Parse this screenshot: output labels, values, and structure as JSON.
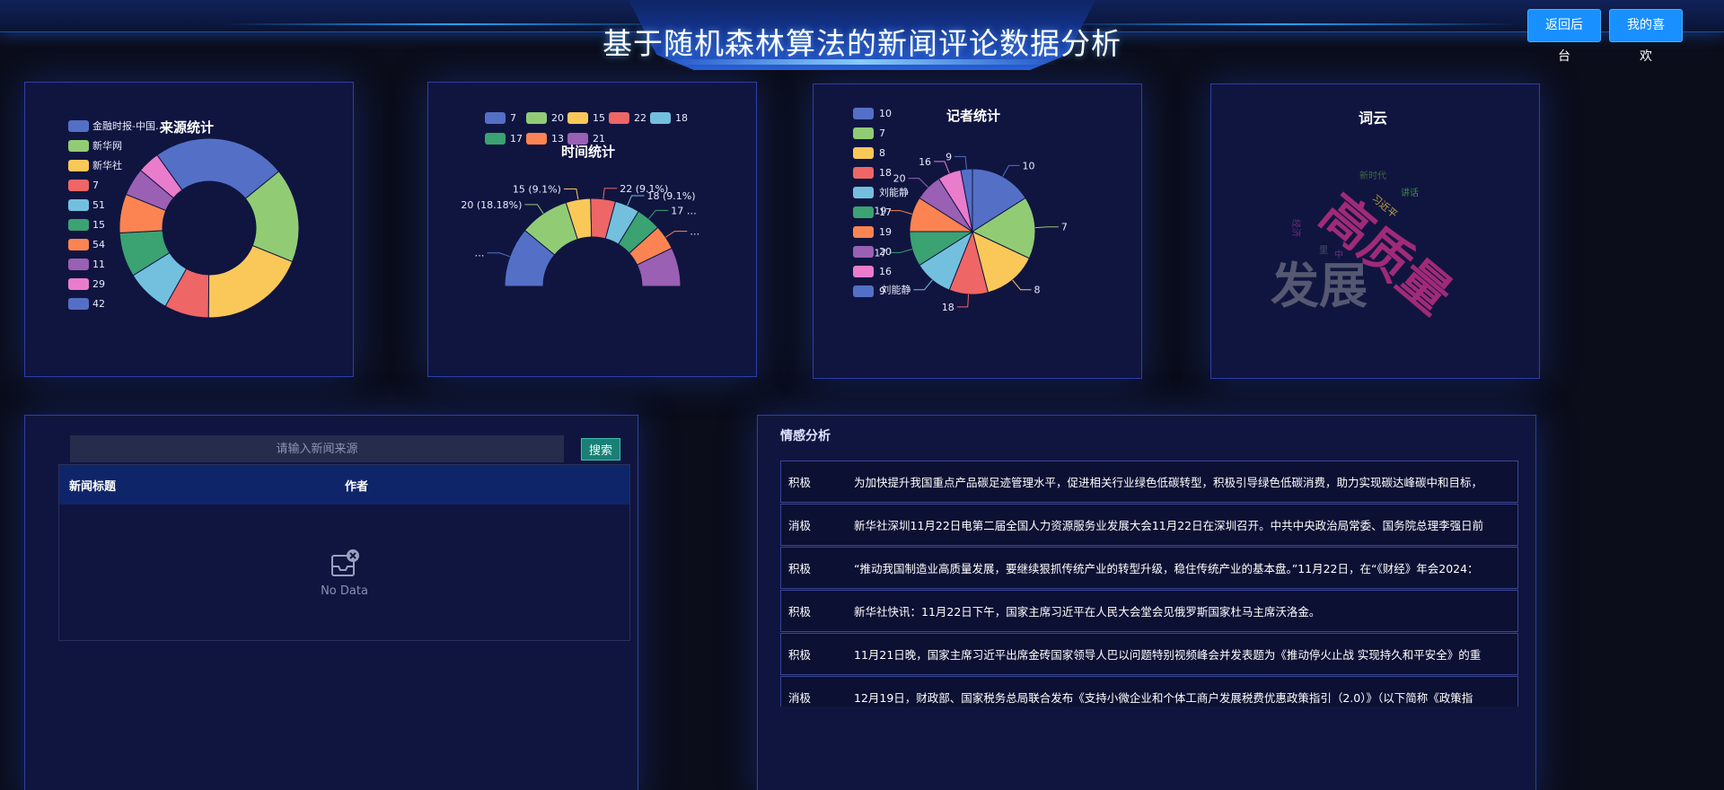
{
  "header": {
    "title": "基于随机森林算法的新闻评论数据分析",
    "buttons": {
      "back": "返回后台",
      "favorites": "我的喜欢"
    }
  },
  "charts": {
    "source": {
      "title": "来源统计",
      "legend": [
        "金融时报-中国…",
        "新华网",
        "新华社",
        "7",
        "51",
        "15",
        "54",
        "11",
        "29",
        "42"
      ]
    },
    "time": {
      "title": "时间统计",
      "legend": [
        "7",
        "20",
        "15",
        "22",
        "18",
        "17",
        "13",
        "21"
      ]
    },
    "reporter": {
      "title": "记者统计",
      "legend": [
        "10",
        "7",
        "8",
        "18",
        "刘能静",
        "17",
        "19",
        "20",
        "16",
        "9 刘能静"
      ]
    },
    "wordcloud": {
      "title": "词云"
    }
  },
  "chart_data": [
    {
      "type": "pie",
      "title": "来源统计",
      "donut": true,
      "legend_position": "left",
      "categories": [
        "金融时报-中国…",
        "新华网",
        "新华社",
        "7",
        "51",
        "15",
        "54",
        "11",
        "29",
        "42"
      ],
      "values": [
        24,
        17,
        19,
        8,
        8,
        8,
        7,
        5,
        4,
        0
      ]
    },
    {
      "type": "pie",
      "title": "时间统计",
      "half_donut": true,
      "legend_position": "top",
      "categories": [
        "7",
        "20",
        "15",
        "22",
        "18",
        "17",
        "13",
        "21"
      ],
      "values": [
        22,
        18.18,
        9.1,
        9.1,
        9.1,
        9.1,
        9.1,
        14.31
      ],
      "data_labels": [
        "…",
        "20 (18.18%)",
        "15 (9.1%)",
        "22 (9.1%)",
        "18 (9.1%)",
        "17 …",
        "…",
        ""
      ]
    },
    {
      "type": "pie",
      "title": "记者统计",
      "legend_position": "left",
      "categories": [
        "10",
        "7",
        "8",
        "18",
        "刘能静",
        "17",
        "19",
        "20",
        "16",
        "9"
      ],
      "values": [
        16,
        16,
        14,
        10,
        10,
        9,
        9,
        7,
        6,
        3
      ],
      "data_labels": [
        "10",
        "7",
        "8",
        "18",
        "刘能静",
        "17",
        "19",
        "20",
        "16",
        "9"
      ]
    }
  ],
  "wordcloud": {
    "words": [
      {
        "text": "高质量",
        "color": "#a02a78"
      },
      {
        "text": "发展",
        "color": "#555870"
      },
      {
        "text": "习近平",
        "color": "#c7a23c"
      },
      {
        "text": "讲话",
        "color": "#3d8f3d"
      },
      {
        "text": "新时代",
        "color": "#3a6d3a"
      },
      {
        "text": "经济",
        "color": "#6a2d7d"
      },
      {
        "text": "中",
        "color": "#6a2d7d"
      },
      {
        "text": "里",
        "color": "#4d4f6a"
      }
    ]
  },
  "search": {
    "placeholder": "请输入新闻来源",
    "button": "搜索",
    "columns": [
      "新闻标题",
      "作者"
    ],
    "empty_text": "No Data"
  },
  "sentiment": {
    "title": "情感分析",
    "rows": [
      {
        "label": "积极",
        "text": "为加快提升我国重点产品碳足迹管理水平，促进相关行业绿色低碳转型，积极引导绿色低碳消费，助力实现碳达峰碳中和目标，"
      },
      {
        "label": "消极",
        "text": "新华社深圳11月22日电第二届全国人力资源服务业发展大会11月22日在深圳召开。中共中央政治局常委、国务院总理李强日前"
      },
      {
        "label": "积极",
        "text": "“推动我国制造业高质量发展，要继续狠抓传统产业的转型升级，稳住传统产业的基本盘。”11月22日，在“《财经》年会2024："
      },
      {
        "label": "积极",
        "text": "新华社快讯：11月22日下午，国家主席习近平在人民大会堂会见俄罗斯国家杜马主席沃洛金。"
      },
      {
        "label": "积极",
        "text": "11月21日晚，国家主席习近平出席金砖国家领导人巴以问题特别视频峰会并发表题为《推动停火止战 实现持久和平安全》的重"
      },
      {
        "label": "消极",
        "text": "12月19日，财政部、国家税务总局联合发布《支持小微企业和个体工商户发展税费优惠政策指引（2.0）》（以下简称《政策指"
      }
    ]
  },
  "colors": {
    "palette": [
      "#5470c6",
      "#91cc75",
      "#fac858",
      "#ee6666",
      "#73c0de",
      "#3ba272",
      "#fc8452",
      "#9a60b4",
      "#ea7ccc",
      "#5470c6"
    ],
    "accent": "#1890ff",
    "panel_bg": "#101540",
    "panel_border": "#2e3fa8"
  }
}
